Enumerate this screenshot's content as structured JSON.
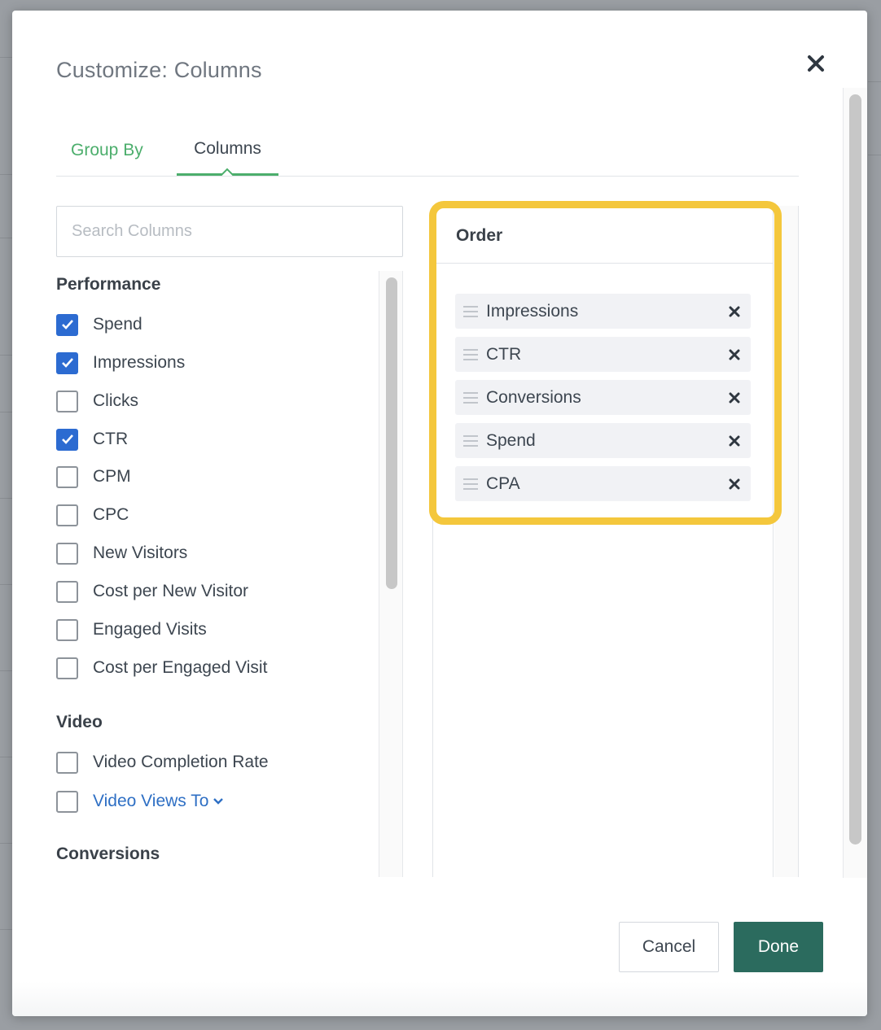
{
  "modal": {
    "title": "Customize: Columns",
    "close_icon": "close-icon"
  },
  "tabs": [
    {
      "label": "Group By",
      "active": false
    },
    {
      "label": "Columns",
      "active": true
    }
  ],
  "search": {
    "placeholder": "Search Columns",
    "value": ""
  },
  "groups": {
    "performance": {
      "title": "Performance",
      "items": [
        {
          "label": "Spend",
          "checked": true
        },
        {
          "label": "Impressions",
          "checked": true
        },
        {
          "label": "Clicks",
          "checked": false
        },
        {
          "label": "CTR",
          "checked": true
        },
        {
          "label": "CPM",
          "checked": false
        },
        {
          "label": "CPC",
          "checked": false
        },
        {
          "label": "New Visitors",
          "checked": false
        },
        {
          "label": "Cost per New Visitor",
          "checked": false
        },
        {
          "label": "Engaged Visits",
          "checked": false
        },
        {
          "label": "Cost per Engaged Visit",
          "checked": false
        }
      ]
    },
    "video": {
      "title": "Video",
      "items": [
        {
          "label": "Video Completion Rate",
          "checked": false
        },
        {
          "label": "Video Views To",
          "checked": false,
          "dropdown": true
        }
      ]
    },
    "conversions": {
      "title": "Conversions"
    }
  },
  "order": {
    "title": "Order",
    "items": [
      "Impressions",
      "CTR",
      "Conversions",
      "Spend",
      "CPA"
    ]
  },
  "footer": {
    "cancel_label": "Cancel",
    "done_label": "Done"
  },
  "colors": {
    "accent_green": "#4cae6c",
    "checkbox_blue": "#2c6bd1",
    "done_button": "#2b6b5e",
    "highlight": "#f4c73c",
    "link_blue": "#2e6fc4"
  }
}
